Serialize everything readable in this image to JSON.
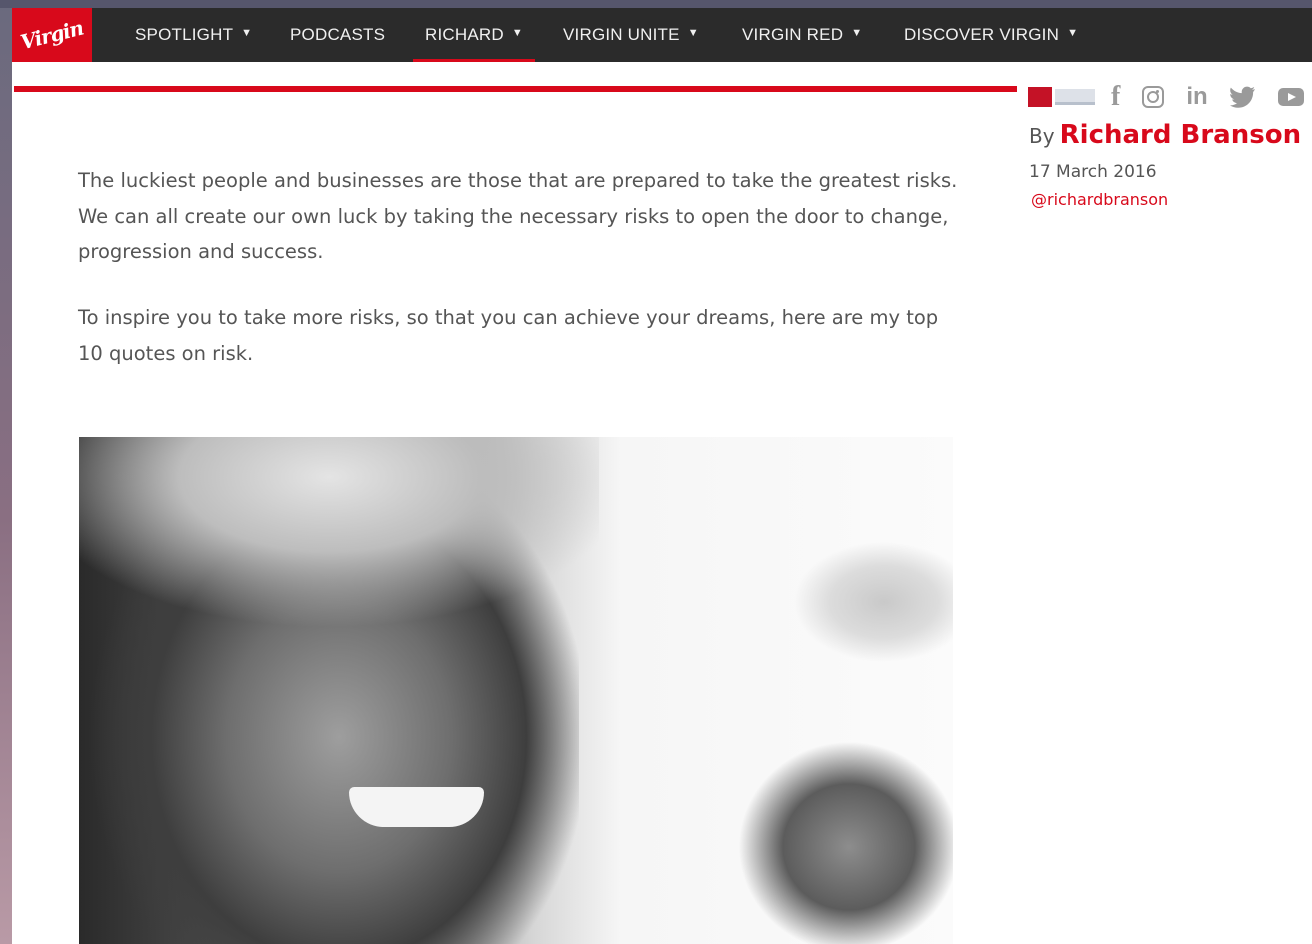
{
  "nav": {
    "logo_text": "Virgin",
    "items": [
      {
        "label": "SPOTLIGHT",
        "has_dropdown": true
      },
      {
        "label": "PODCASTS",
        "has_dropdown": false
      },
      {
        "label": "RICHARD",
        "has_dropdown": true,
        "active": true
      },
      {
        "label": "VIRGIN UNITE",
        "has_dropdown": true
      },
      {
        "label": "VIRGIN RED",
        "has_dropdown": true
      },
      {
        "label": "DISCOVER VIRGIN",
        "has_dropdown": true
      }
    ]
  },
  "share": {
    "icons": [
      "facebook-icon",
      "instagram-icon",
      "linkedin-icon",
      "twitter-icon",
      "youtube-icon"
    ]
  },
  "author": {
    "by_label": "By",
    "name": "Richard Branson",
    "date": "17 March 2016",
    "handle": "@richardbranson"
  },
  "article": {
    "paragraphs": [
      "The luckiest people and businesses are those that are prepared to take the greatest risks. We can all create our own luck by taking the necessary risks to open the door to change, progression and success.",
      "To inspire you to take more risks, so that you can achieve your dreams, here are my top 10 quotes on risk."
    ]
  },
  "colors": {
    "brand_red": "#d8091b",
    "nav_bg": "#2b2b2b",
    "body_text": "#555555"
  }
}
